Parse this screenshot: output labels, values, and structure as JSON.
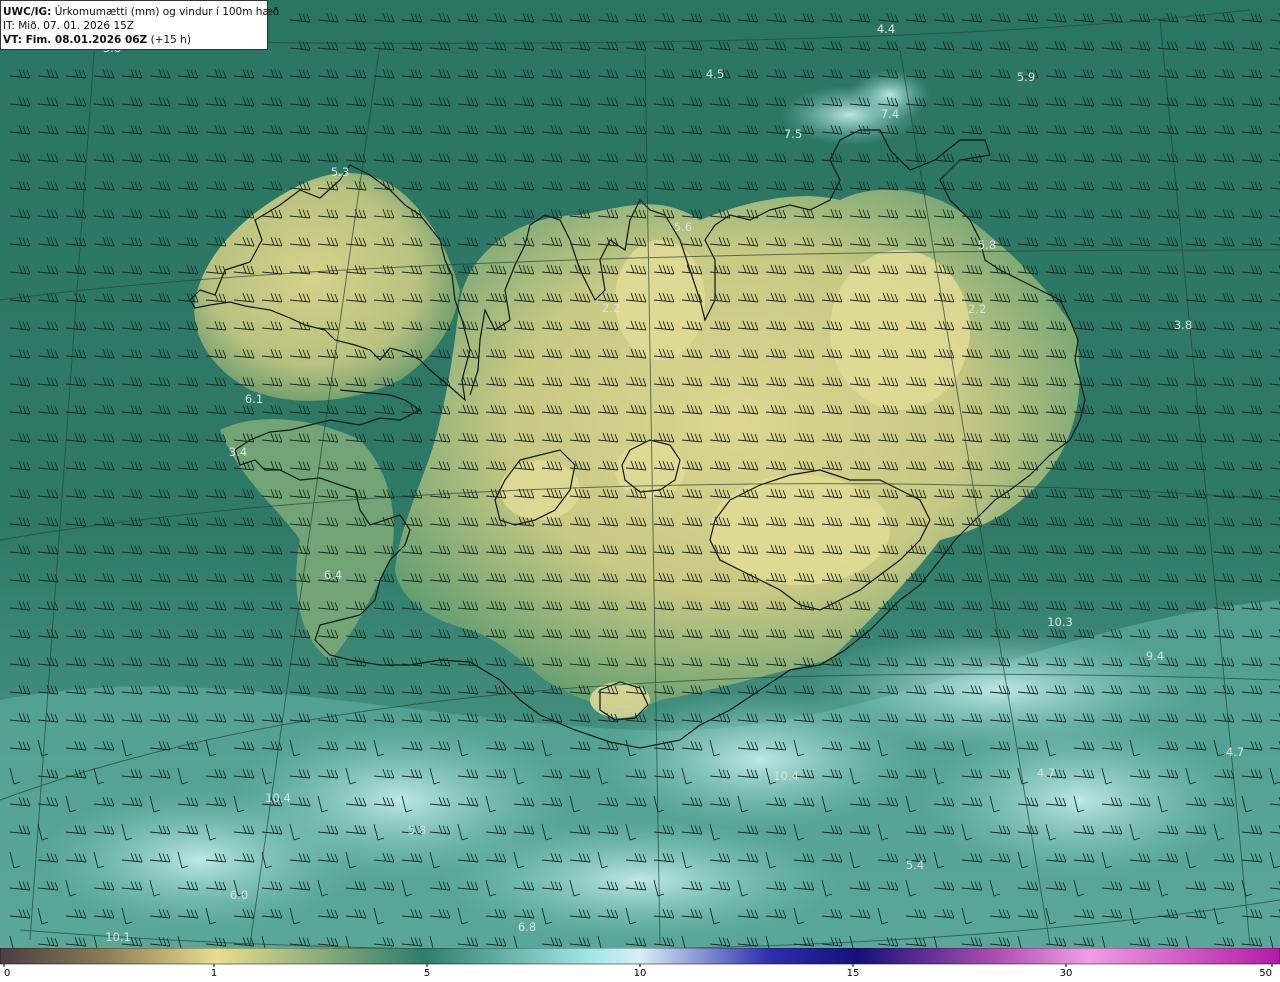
{
  "header": {
    "model_prefix": "UWC/IG:",
    "title": "Úrkomumætti (mm) og vindur í 100m hæð",
    "it_line": "IT: Mið. 07. 01. 2026 15Z",
    "vt_prefix": "VT: Fim. 08.01.2026 06Z",
    "vt_suffix": "(+15 h)"
  },
  "map": {
    "value_labels": [
      "3.8",
      "4.4",
      "4.5",
      "5.9",
      "7.5",
      "7.4",
      "5.3",
      "5.6",
      "5.8",
      "2.2",
      "3.8",
      "6.1",
      "3.4",
      "6.4",
      "10.3",
      "9.4",
      "4.7",
      "4.7",
      "10.4",
      "10.4",
      "5.8",
      "5.4",
      "6.0",
      "6.8",
      "10.1",
      "2.2"
    ],
    "colors": {
      "ocean": "#2f7a66",
      "land_low": "#5d9a6a",
      "land_high": "#d8d38b",
      "high_precip": "#b6e0dc",
      "coast": "#0b1a12",
      "barb": "#1c2b27",
      "grid_line": "#2a4d42"
    }
  },
  "colorbar": {
    "ticks": [
      "0",
      "1",
      "5",
      "10",
      "15",
      "30",
      "50"
    ],
    "stops": [
      "#4a3e44",
      "#8a7a55",
      "#e9dd8d",
      "#2e7d6b",
      "#9fe7e5",
      "#d7eff5",
      "#2f2fb0",
      "#151178",
      "#b04fb4",
      "#ef9de6",
      "#b21aa6"
    ]
  }
}
